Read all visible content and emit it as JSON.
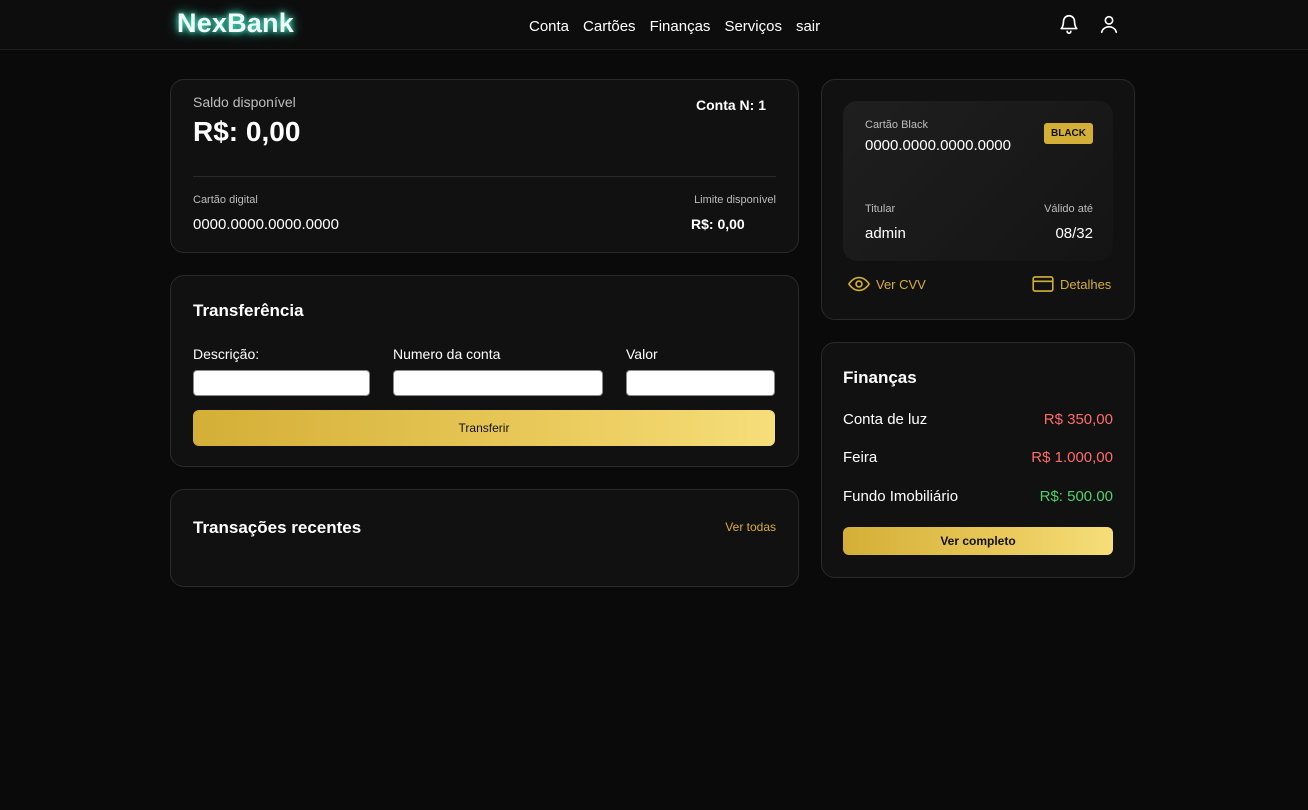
{
  "brand": {
    "name": "NexBank"
  },
  "nav": {
    "items": [
      "Conta",
      "Cartões",
      "Finanças",
      "Serviços",
      "sair"
    ]
  },
  "header_icons": {
    "notifications": "bell-icon",
    "profile": "user-icon"
  },
  "balance": {
    "label": "Saldo disponível",
    "value": "R$: 0,00",
    "account_label": "Conta N: 1",
    "digital_card_label": "Cartão digital",
    "digital_card_number": "0000.0000.0000.0000",
    "limit_label": "Limite disponível",
    "limit_value": "R$: 0,00"
  },
  "transfer": {
    "title": "Transferência",
    "description_label": "Descrição:",
    "account_label": "Numero da conta",
    "value_label": "Valor",
    "description_value": "",
    "account_value": "",
    "amount_value": "",
    "button_label": "Transferir"
  },
  "transactions": {
    "title": "Transações recentes",
    "see_all": "Ver todas"
  },
  "credit_card": {
    "type_label": "Cartão Black",
    "number": "0000.0000.0000.0000",
    "badge": "BLACK",
    "holder_label": "Titular",
    "holder": "admin",
    "valid_label": "Válido até",
    "valid": "08/32",
    "cvv_action": "Ver CVV",
    "details_action": "Detalhes"
  },
  "finances": {
    "title": "Finanças",
    "items": [
      {
        "name": "Conta de luz",
        "amount": "R$ 350,00",
        "color": "#ff6b6b"
      },
      {
        "name": "Feira",
        "amount": "R$ 1.000,00",
        "color": "#ff6b6b"
      },
      {
        "name": "Fundo Imobiliário",
        "amount": "R$: 500.00",
        "color": "#4cd16a"
      }
    ],
    "button_label": "Ver completo"
  },
  "colors": {
    "accent_gold": "#d4af37",
    "background": "#0a0a0a",
    "card": "#111111",
    "negative": "#ff6b6b",
    "positive": "#4cd16a",
    "logo_glow": "#27d6b0"
  }
}
